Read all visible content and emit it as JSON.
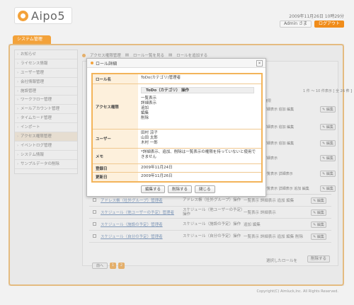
{
  "header": {
    "logo_text": "Aipo5",
    "datetime": "2009年11月26日  10時29分",
    "user_label": "Admin さま",
    "logout_label": "ログアウト"
  },
  "tab": {
    "label": "システム管理"
  },
  "sidebar": {
    "items": [
      {
        "label": "お知らせ"
      },
      {
        "label": "ライセンス情報"
      },
      {
        "label": "ユーザー管理"
      },
      {
        "label": "会社情報管理"
      },
      {
        "label": "施設管理"
      },
      {
        "label": "ワークフロー管理"
      },
      {
        "label": "メールアカウント管理"
      },
      {
        "label": "タイムカード管理"
      },
      {
        "label": "インポート"
      },
      {
        "label": "アクセス権限管理"
      },
      {
        "label": "イベントログ管理"
      },
      {
        "label": "システム情報"
      },
      {
        "label": "サンプルデータの削除"
      }
    ]
  },
  "content_header": {
    "title": "アクセス権限管理",
    "link_list": "ロール一覧を見る",
    "link_add": "ロールを追加する"
  },
  "background": {
    "range_text": "1 件 ～ 10 件表示 [ 全 26 件 ]",
    "col_ops": "権限",
    "edit_label": "編集",
    "rows": [
      {
        "ops": "詳細表示  追加  編集"
      },
      {
        "ops": "詳細表示  追加  編集"
      },
      {
        "ops": "詳細表示  追加  編集"
      },
      {
        "ops": "詳細表示"
      },
      {
        "ops": "一覧表示  詳細表示"
      },
      {
        "ops": "一覧表示  詳細表示  追加  編集"
      }
    ],
    "lower_rows": [
      {
        "name": "アドレス帳（社外グループ）管理者",
        "desc": "アドレス帳（社外グループ）操作",
        "ops": "一覧表示  詳細表示  追加  編集",
        "edit": "編集"
      },
      {
        "name": "スケジュール（他ユーザーの予定）管理者",
        "desc": "スケジュール（他ユーザーの予定）操作",
        "ops": "一覧表示  詳細表示",
        "edit": "編集"
      },
      {
        "name": "スケジュール（施設の予定）管理者",
        "desc": "スケジュール（施設の予定）操作",
        "ops": "追加  編集",
        "edit": "編集"
      },
      {
        "name": "スケジュール（自分の予定）管理者",
        "desc": "スケジュール（自分の予定）操作",
        "ops": "一覧表示  詳細表示  追加  編集  削除",
        "edit": "編集"
      }
    ],
    "pager": {
      "prev_label": "前へ",
      "pages": [
        "1",
        "2"
      ]
    },
    "bulk_label": "選択したロールを",
    "bulk_delete": "削除する"
  },
  "dialog": {
    "title": "ロール詳細",
    "close_label": "×",
    "labels": {
      "role_name": "ロール名",
      "access": "アクセス権限",
      "users": "ユーザー",
      "memo": "メモ",
      "created": "登録日",
      "updated": "更新日"
    },
    "role_name": "ToDo(カテゴリ)管理者",
    "access_header": "ToDo（カテゴリ）  操作",
    "access_ops": [
      "一覧表示",
      "詳細表示",
      "追加",
      "編集",
      "削除"
    ],
    "users": [
      "田村 涼子",
      "山田 太郎",
      "木村 一郎"
    ],
    "memo": "*詳細表示、追加、削除は一覧表示の権限を持っていないと使用できません",
    "created": "2009年11月24日",
    "updated": "2009年11月26日",
    "buttons": {
      "edit": "編集する",
      "delete": "削除する",
      "close": "閉じる"
    }
  },
  "footer": {
    "copyright": "Copyright(C) Aimluck,Inc. All Rights Reserved."
  },
  "colors": {
    "accent": "#f3a23a",
    "logout": "#f08c1a",
    "link": "#5a7fb0"
  }
}
